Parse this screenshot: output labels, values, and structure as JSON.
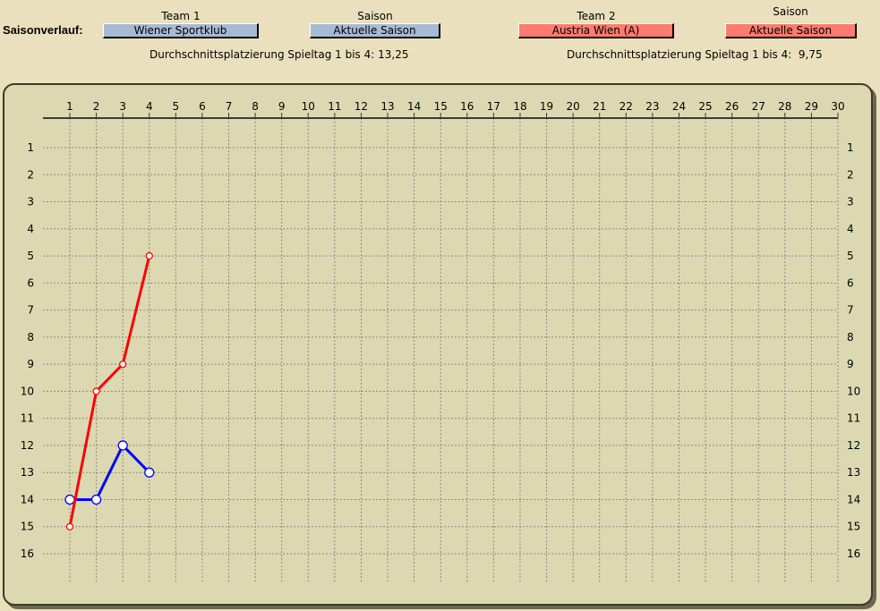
{
  "header": {
    "title": "Saisonverlauf:",
    "team1": {
      "label": "Team 1",
      "value": "Wiener Sportklub"
    },
    "season1": {
      "label": "Saison",
      "value": "Aktuelle Saison"
    },
    "team2": {
      "label": "Team 2",
      "value": "Austria Wien (A)"
    },
    "season2": {
      "label": "Saison",
      "value": "Aktuelle Saison"
    },
    "avg1": "Durchschnittsplatzierung Spieltag 1 bis 4: 13,25",
    "avg2": "Durchschnittsplatzierung Spieltag 1 bis 4:  9,75"
  },
  "colors": {
    "team1": "#0000ff",
    "team2": "#ff0000",
    "team1_box": "#a7bad4",
    "team2_box": "#fb7b6f"
  },
  "chart_data": {
    "type": "line",
    "x": [
      1,
      2,
      3,
      4,
      5,
      6,
      7,
      8,
      9,
      10,
      11,
      12,
      13,
      14,
      15,
      16,
      17,
      18,
      19,
      20,
      21,
      22,
      23,
      24,
      25,
      26,
      27,
      28,
      29,
      30
    ],
    "xlim": [
      1,
      30
    ],
    "ylim": [
      1,
      16
    ],
    "y_inverted": true,
    "y_ticks": [
      1,
      2,
      3,
      4,
      5,
      6,
      7,
      8,
      9,
      10,
      11,
      12,
      13,
      14,
      15,
      16
    ],
    "grid": true,
    "series": [
      {
        "color": "#0000ff",
        "x": [
          1,
          2,
          3,
          4
        ],
        "y": [
          14,
          14,
          12,
          13
        ]
      },
      {
        "color": "#ff0000",
        "x": [
          1,
          2,
          3,
          4
        ],
        "y": [
          15,
          10,
          9,
          5
        ]
      }
    ]
  }
}
